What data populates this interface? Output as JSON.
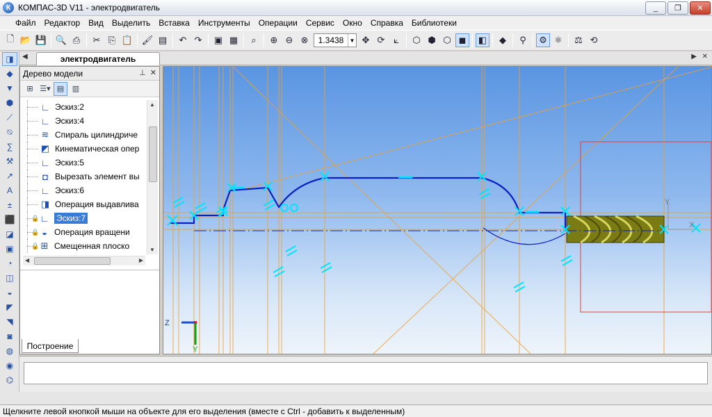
{
  "window": {
    "title": "КОМПАС-3D V11 - электродвигатель",
    "app_icon_letter": "К",
    "minimize": "_",
    "restore": "❐",
    "close": "✕"
  },
  "menu": {
    "items": [
      "Файл",
      "Редактор",
      "Вид",
      "Выделить",
      "Вставка",
      "Инструменты",
      "Операции",
      "Сервис",
      "Окно",
      "Справка",
      "Библиотеки"
    ]
  },
  "toolbar": {
    "zoom_value": "1.3438"
  },
  "document": {
    "tab_title": "электродвигатель"
  },
  "tree": {
    "header": "Дерево модели",
    "pin_icon": "⊥",
    "close_icon": "✕",
    "items": [
      {
        "label": "Эскиз:2",
        "icon": "sketch-icon",
        "locked": false,
        "selected": false
      },
      {
        "label": "Эскиз:4",
        "icon": "sketch-icon",
        "locked": false,
        "selected": false
      },
      {
        "label": "Спираль цилиндриче",
        "icon": "spiral-icon",
        "locked": false,
        "selected": false
      },
      {
        "label": "Кинематическая опер",
        "icon": "sweep-icon",
        "locked": false,
        "selected": false
      },
      {
        "label": "Эскиз:5",
        "icon": "sketch-icon",
        "locked": false,
        "selected": false
      },
      {
        "label": "Вырезать элемент вы",
        "icon": "cut-icon",
        "locked": false,
        "selected": false
      },
      {
        "label": "Эскиз:6",
        "icon": "sketch-icon",
        "locked": false,
        "selected": false
      },
      {
        "label": "Операция выдавлива",
        "icon": "extrude-icon",
        "locked": false,
        "selected": false
      },
      {
        "label": "Эскиз:7",
        "icon": "sketch-icon",
        "locked": true,
        "selected": true
      },
      {
        "label": "Операция вращени",
        "icon": "revolve-icon",
        "locked": true,
        "selected": false
      },
      {
        "label": "Смещенная плоско",
        "icon": "plane-icon",
        "locked": true,
        "selected": false
      }
    ],
    "bottom_tab": "Построение"
  },
  "viewport": {
    "axis_z_label": "Z",
    "axis_y_label": "Y",
    "axis_x_label": "X",
    "axis_y_small": "Y"
  },
  "status": {
    "message": "Щелкните левой кнопкой мыши на объекте для его выделения (вместе с Ctrl - добавить к выделенным)"
  },
  "colors": {
    "sketch_line": "#0a1fc4",
    "constraint": "#00e5ff",
    "construction": "#f0a030",
    "bounding_box": "#e04040",
    "drill_body": "#8a8a1a"
  }
}
